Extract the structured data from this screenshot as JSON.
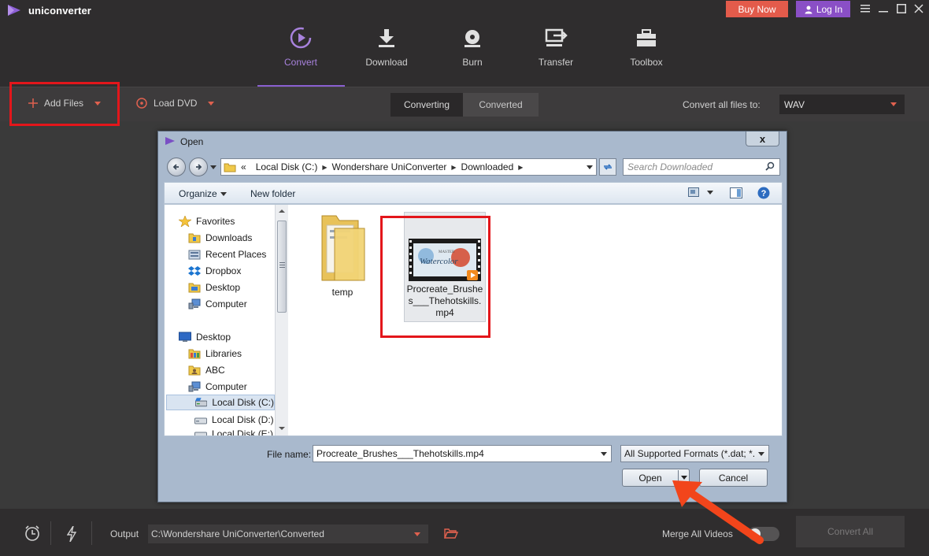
{
  "app": {
    "name": "uniconverter",
    "buy_label": "Buy Now",
    "login_label": "Log In"
  },
  "colors": {
    "accent": "#8a5fd0",
    "buy": "#e35b4b",
    "login": "#8a4fc6",
    "highlight": "#e3161b",
    "arrow": "#f2451b"
  },
  "nav": {
    "items": [
      {
        "label": "Convert",
        "icon": "convert-icon",
        "active": true
      },
      {
        "label": "Download",
        "icon": "download-icon"
      },
      {
        "label": "Burn",
        "icon": "burn-icon"
      },
      {
        "label": "Transfer",
        "icon": "transfer-icon"
      },
      {
        "label": "Toolbox",
        "icon": "toolbox-icon"
      }
    ]
  },
  "toolbar": {
    "add_files": "Add Files",
    "load_dvd": "Load DVD",
    "tab_converting": "Converting",
    "tab_converted": "Converted",
    "convert_all_to": "Convert all files to:",
    "format": "WAV"
  },
  "dialog": {
    "title": "Open",
    "close": "x",
    "breadcrumb": [
      "«",
      "Local Disk (C:)",
      "Wondershare UniConverter",
      "Downloaded"
    ],
    "search_placeholder": "Search Downloaded",
    "organize": "Organize",
    "new_folder": "New folder",
    "tree": [
      {
        "label": "Favorites",
        "icon": "star-icon"
      },
      {
        "label": "Downloads",
        "icon": "folder-icon"
      },
      {
        "label": "Recent Places",
        "icon": "recent-icon"
      },
      {
        "label": "Dropbox",
        "icon": "dropbox-icon"
      },
      {
        "label": "Desktop",
        "icon": "folder-icon"
      },
      {
        "label": "Computer",
        "icon": "computer-icon"
      },
      {
        "label": "Desktop",
        "icon": "desktop-icon"
      },
      {
        "label": "Libraries",
        "icon": "library-icon"
      },
      {
        "label": "ABC",
        "icon": "user-folder-icon"
      },
      {
        "label": "Computer",
        "icon": "computer-icon"
      },
      {
        "label": "Local Disk (C:)",
        "icon": "disk-icon"
      },
      {
        "label": "Local Disk (D:)",
        "icon": "disk-icon"
      },
      {
        "label": "Local Disk (E:)",
        "icon": "disk-icon"
      }
    ],
    "files": [
      {
        "name": "temp",
        "type": "folder"
      },
      {
        "name": "Procreate_Brushes___Thehotskills.mp4",
        "name_lines": [
          "Procreate_Brushe",
          "s___Thehotskills.",
          "mp4"
        ],
        "type": "video"
      }
    ],
    "thumbnail_text": [
      "MASTER",
      "Watercolor"
    ],
    "file_name_label": "File name:",
    "file_name_value": "Procreate_Brushes___Thehotskills.mp4",
    "filter_value": "All Supported Formats (*.dat; *.",
    "open_label": "Open",
    "cancel_label": "Cancel"
  },
  "bottom": {
    "output_label": "Output",
    "output_path": "C:\\Wondershare UniConverter\\Converted",
    "merge_label": "Merge All Videos",
    "convert_all": "Convert All"
  }
}
